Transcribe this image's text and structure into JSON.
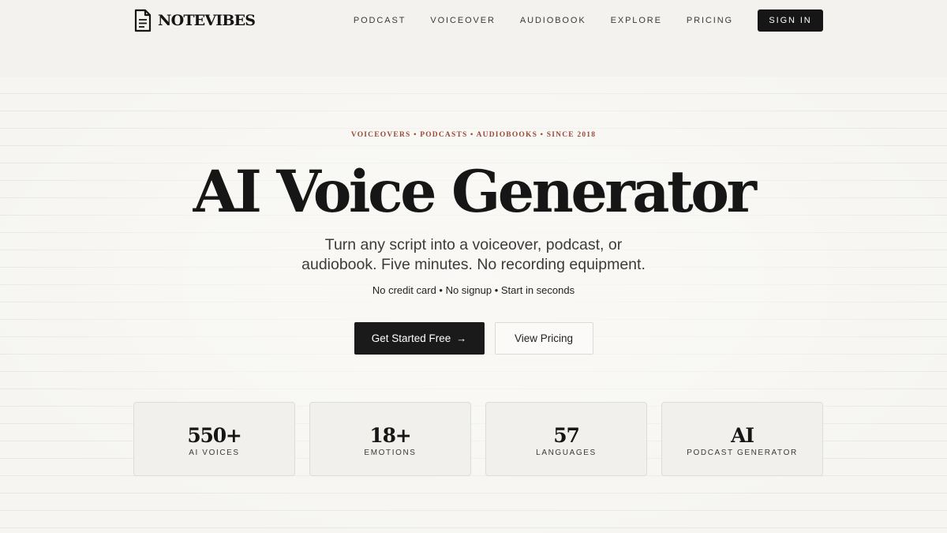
{
  "brand": {
    "name": "NOTEVIBES",
    "icon": "document-icon"
  },
  "nav": {
    "items": [
      "PODCAST",
      "VOICEOVER",
      "AUDIOBOOK",
      "EXPLORE",
      "PRICING"
    ],
    "signin_label": "SIGN IN"
  },
  "hero": {
    "kicker": "VOICEOVERS • PODCASTS • AUDIOBOOKS • SINCE 2018",
    "title": "AI Voice Generator",
    "subtitle_line1": "Turn any script into a voiceover, podcast, or",
    "subtitle_line2": "audiobook. Five minutes. No recording equipment.",
    "note": "No credit card • No signup • Start in seconds",
    "primary_cta": "Get Started Free",
    "primary_cta_icon": "arrow-right-icon",
    "secondary_cta": "View Pricing"
  },
  "stats": [
    {
      "value": "550+",
      "label": "AI VOICES"
    },
    {
      "value": "18+",
      "label": "EMOTIONS"
    },
    {
      "value": "57",
      "label": "LANGUAGES"
    },
    {
      "value": "AI",
      "label": "PODCAST GENERATOR"
    }
  ],
  "colors": {
    "background": "#f4f3ef",
    "dark": "#161616",
    "kicker": "#9a4a3a",
    "card": "#f1f0ec"
  }
}
